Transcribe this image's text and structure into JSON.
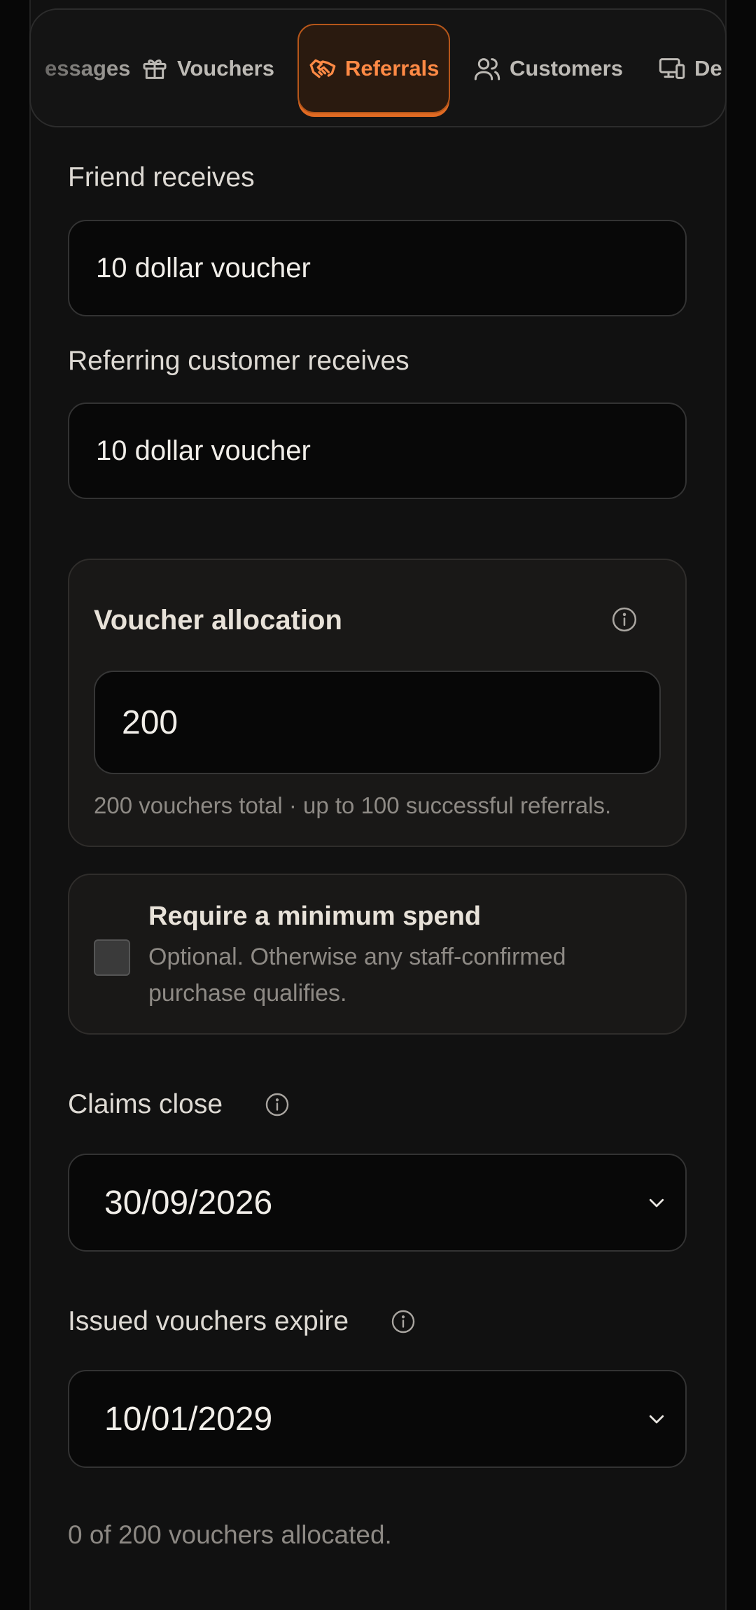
{
  "tabs": [
    {
      "label": "essages",
      "icon": "messages-icon"
    },
    {
      "label": "Vouchers",
      "icon": "gift-icon"
    },
    {
      "label": "Referrals",
      "icon": "handshake-icon",
      "active": true
    },
    {
      "label": "Customers",
      "icon": "users-icon"
    },
    {
      "label": "De",
      "icon": "devices-icon"
    }
  ],
  "form": {
    "friend_receives": {
      "label": "Friend receives",
      "value": "10 dollar voucher"
    },
    "referrer_receives": {
      "label": "Referring customer receives",
      "value": "10 dollar voucher"
    },
    "allocation": {
      "title": "Voucher allocation",
      "value": "200",
      "help": "200 vouchers total · up to 100 successful referrals."
    },
    "min_spend": {
      "title": "Require a minimum spend",
      "help_line1": "Optional. Otherwise any staff-confirmed",
      "help_line2": "purchase qualifies.",
      "checked": false
    },
    "claims_close": {
      "label": "Claims close",
      "value": "30/09/2026"
    },
    "vouchers_expire": {
      "label": "Issued vouchers expire",
      "value": "10/01/2029"
    },
    "status": "0 of 200 vouchers allocated."
  },
  "colors": {
    "accent": "#ff8a45",
    "background": "#111111",
    "field": "#080808"
  }
}
